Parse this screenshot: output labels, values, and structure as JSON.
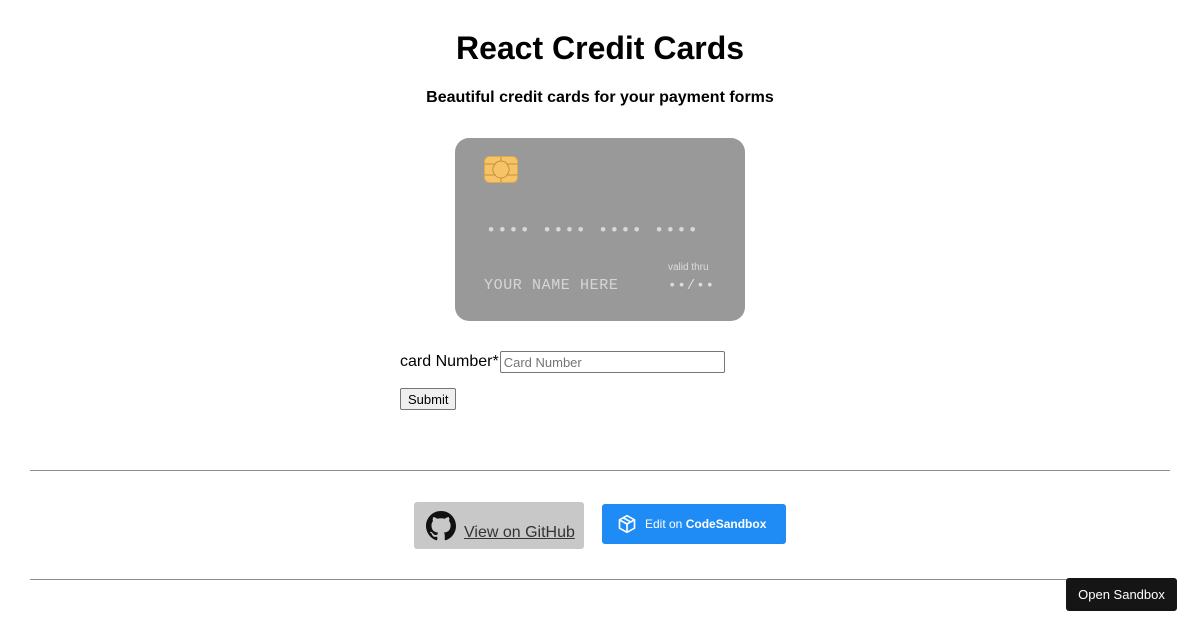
{
  "header": {
    "title": "React Credit Cards",
    "subtitle": "Beautiful credit cards for your payment forms"
  },
  "card": {
    "number_placeholder": "•••• •••• •••• ••••",
    "name_placeholder": "YOUR NAME HERE",
    "valid_label": "valid thru",
    "expiry_placeholder": "••/••",
    "background_color": "#999999",
    "chip_color": "#f5c46a"
  },
  "form": {
    "card_number_label": "card Number*",
    "card_number_placeholder": "Card Number",
    "card_number_value": "",
    "submit_label": "Submit"
  },
  "links": {
    "github_label": "View on GitHub",
    "github_icon": "github-icon",
    "codesandbox_prefix": "Edit on ",
    "codesandbox_brand": "CodeSandbox",
    "codesandbox_icon": "codesandbox-cube-icon",
    "codesandbox_color": "#1f8cf5"
  },
  "floating": {
    "open_sandbox_label": "Open Sandbox"
  }
}
